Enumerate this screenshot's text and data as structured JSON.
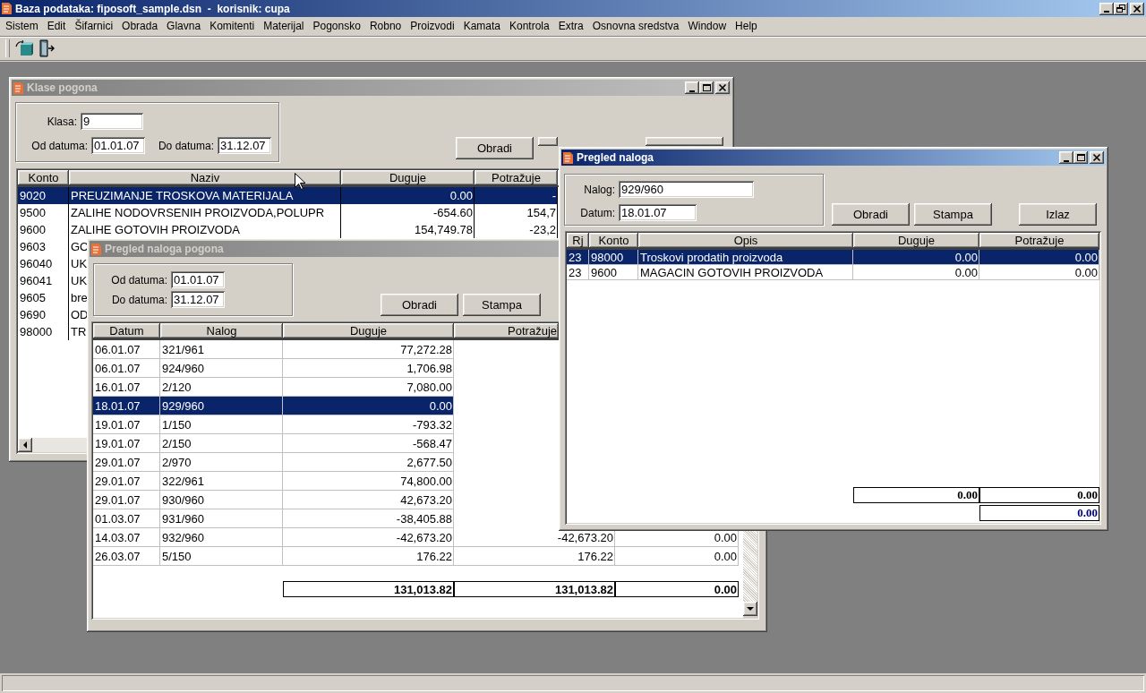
{
  "app": {
    "title": "Baza podataka: fiposoft_sample.dsn  -  korisnik: cupa"
  },
  "menu": [
    "Sistem",
    "Edit",
    "Šifarnici",
    "Obrada",
    "Glavna",
    "Komitenti",
    "Materijal",
    "Pogonsko",
    "Robno",
    "Proizvodi",
    "Kamata",
    "Kontrola",
    "Extra",
    "Osnovna sredstva",
    "Window",
    "Help"
  ],
  "klase_pogona": {
    "title": "Klase pogona",
    "active": false,
    "klasa": {
      "label": "Klasa:",
      "value": "9"
    },
    "od_datuma": {
      "label": "Od datuma:",
      "value": "01.01.07"
    },
    "do_datuma": {
      "label": "Do datuma:",
      "value": "31.12.07"
    },
    "buttons": [
      "Obradi"
    ],
    "columns": [
      "Konto",
      "Naziv",
      "Duguje",
      "Potražuje"
    ],
    "rows": [
      {
        "konto": "9020",
        "naziv": "PREUZIMANJE TROSKOVA MATERIJALA",
        "duguje": "0.00",
        "potrazuje": "-",
        "selected": true
      },
      {
        "konto": "9500",
        "naziv": "ZALIHE NODOVRSENIH PROIZVODA,POLUPR",
        "duguje": "-654.60",
        "potrazuje": "154,7",
        "selected": false
      },
      {
        "konto": "9600",
        "naziv": "ZALIHE GOTOVIH PROIZVODA",
        "duguje": "154,749.78",
        "potrazuje": "-23,2",
        "selected": false
      },
      {
        "konto": "9603",
        "naziv": "GO",
        "selected": false
      },
      {
        "konto": "96040",
        "naziv": "UK",
        "selected": false
      },
      {
        "konto": "96041",
        "naziv": "UK",
        "selected": false
      },
      {
        "konto": "9605",
        "naziv": "bre",
        "selected": false
      },
      {
        "konto": "9690",
        "naziv": "OD",
        "selected": false
      },
      {
        "konto": "98000",
        "naziv": "TR",
        "selected": false
      }
    ]
  },
  "pregled_naloga_pogona": {
    "title": "Pregled naloga pogona",
    "active": false,
    "od_datuma": {
      "label": "Od datuma:",
      "value": "01.01.07"
    },
    "do_datuma": {
      "label": "Do datuma:",
      "value": "31.12.07"
    },
    "buttons": [
      "Obradi",
      "Stampa"
    ],
    "columns": [
      "Datum",
      "Nalog",
      "Duguje",
      "Potražuje"
    ],
    "rows": [
      {
        "datum": "06.01.07",
        "nalog": "321/961",
        "duguje": "77,272.28",
        "selected": false
      },
      {
        "datum": "06.01.07",
        "nalog": "924/960",
        "duguje": "1,706.98",
        "selected": false
      },
      {
        "datum": "16.01.07",
        "nalog": "2/120",
        "duguje": "7,080.00",
        "selected": false
      },
      {
        "datum": "18.01.07",
        "nalog": "929/960",
        "duguje": "0.00",
        "selected": true
      },
      {
        "datum": "19.01.07",
        "nalog": "1/150",
        "duguje": "-793.32",
        "selected": false
      },
      {
        "datum": "19.01.07",
        "nalog": "2/150",
        "duguje": "-568.47",
        "selected": false
      },
      {
        "datum": "29.01.07",
        "nalog": "2/970",
        "duguje": "2,677.50",
        "selected": false
      },
      {
        "datum": "29.01.07",
        "nalog": "322/961",
        "duguje": "74,800.00",
        "selected": false
      },
      {
        "datum": "29.01.07",
        "nalog": "930/960",
        "duguje": "42,673.20",
        "selected": false
      },
      {
        "datum": "01.03.07",
        "nalog": "931/960",
        "duguje": "-38,405.88",
        "selected": false
      },
      {
        "datum": "14.03.07",
        "nalog": "932/960",
        "duguje": "-42,673.20",
        "potrazuje": "-42,673.20",
        "column_5": "0.00",
        "selected": false
      },
      {
        "datum": "26.03.07",
        "nalog": "5/150",
        "duguje": "176.22",
        "potrazuje": "176.22",
        "column_5": "0.00",
        "selected": false
      }
    ],
    "totals": [
      "131,013.82",
      "131,013.82",
      "0.00"
    ]
  },
  "pregled_naloga": {
    "title": "Pregled naloga",
    "active": true,
    "nalog": {
      "label": "Nalog:",
      "value": "929/960"
    },
    "datum": {
      "label": "Datum:",
      "value": "18.01.07"
    },
    "buttons": [
      "Obradi",
      "Stampa",
      "Izlaz"
    ],
    "columns": [
      "Rj",
      "Konto",
      "Opis",
      "Duguje",
      "Potražuje"
    ],
    "rows": [
      {
        "rj": "23",
        "konto": "98000",
        "opis": "Troskovi prodatih proizvoda",
        "duguje": "0.00",
        "potrazuje": "0.00",
        "selected": true
      },
      {
        "rj": "23",
        "konto": "9600",
        "opis": "MAGACIN GOTOVIH PROIZVODA",
        "duguje": "0.00",
        "potrazuje": "0.00",
        "selected": false
      }
    ],
    "totals": [
      "0.00",
      "0.00"
    ],
    "balance": "0.00"
  }
}
